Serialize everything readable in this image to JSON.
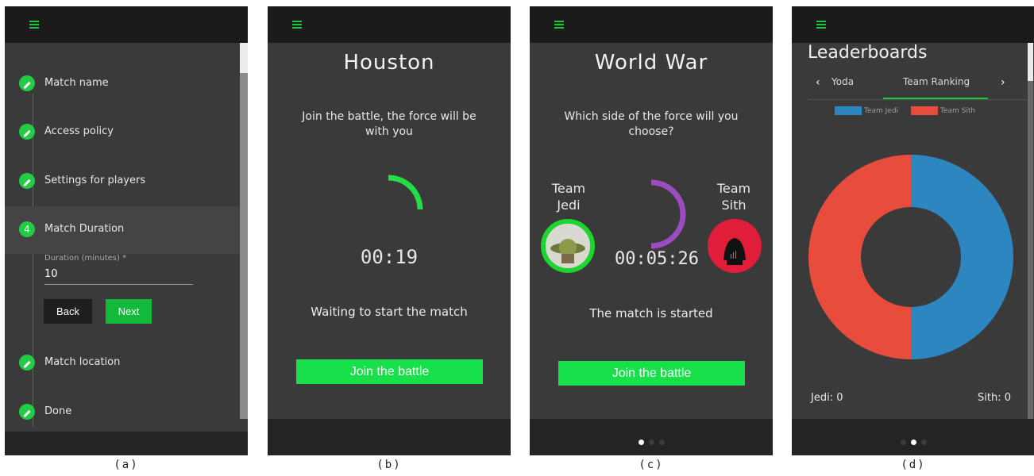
{
  "panel_a": {
    "caption": "(a)",
    "steps": [
      {
        "label": "Match name"
      },
      {
        "label": "Access policy"
      },
      {
        "label": "Settings for players"
      },
      {
        "label": "Match Duration",
        "number": "4"
      },
      {
        "label": "Match location"
      },
      {
        "label": "Done"
      }
    ],
    "duration_label": "Duration (minutes) *",
    "duration_value": "10",
    "back_label": "Back",
    "next_label": "Next"
  },
  "panel_b": {
    "caption": "(b)",
    "title": "Houston",
    "subtitle_line1": "Join the battle, the force will be",
    "subtitle_line2": "with you",
    "timer": "00:19",
    "timer_fraction": 0.25,
    "status": "Waiting to start the match",
    "join_label": "Join the battle"
  },
  "panel_c": {
    "caption": "(c)",
    "title": "World War",
    "subtitle_line1": "Which side of the force will you",
    "subtitle_line2": "choose?",
    "team_left_line1": "Team",
    "team_left_line2": "Jedi",
    "team_right_line1": "Team",
    "team_right_line2": "Sith",
    "timer": "00:05:26",
    "timer_fraction": 0.5,
    "status": "The match is started",
    "join_label": "Join the battle",
    "page_index": 0,
    "page_count": 3
  },
  "panel_d": {
    "caption": "(d)",
    "heading": "Leaderboards",
    "tab_prev": "Yoda",
    "tab_active": "Team Ranking",
    "legend": [
      {
        "name": "Team Jedi",
        "color": "#2e86c1"
      },
      {
        "name": "Team Sith",
        "color": "#e74c3c"
      }
    ],
    "jedi_score": "Jedi: 0",
    "sith_score": "Sith: 0",
    "page_index": 1,
    "page_count": 3
  },
  "chart_data": {
    "type": "pie",
    "categories": [
      "Team Jedi",
      "Team Sith"
    ],
    "values": [
      50,
      50
    ],
    "colors": [
      "#2e86c1",
      "#e74c3c"
    ],
    "legend": "top"
  },
  "colors": {
    "accent": "#22c43c",
    "button": "#17e04a",
    "panel": "#3a3a3a",
    "bar": "#1b1b1b",
    "arc_b": "#22dd44",
    "arc_c": "#9b4dbf"
  }
}
